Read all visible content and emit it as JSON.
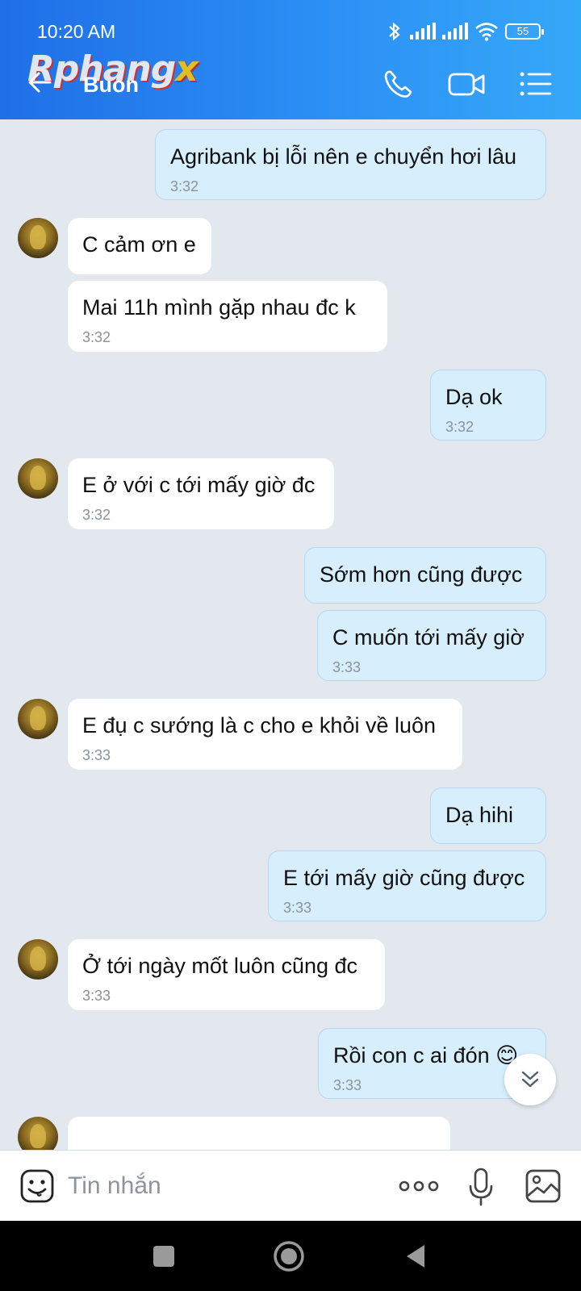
{
  "status": {
    "time": "10:20 AM",
    "battery": "55"
  },
  "header": {
    "title": "Buon",
    "watermark_main": "Rphang",
    "watermark_x": "x"
  },
  "messages": [
    {
      "dir": "out",
      "text": "Agribank bị lỗi nên e chuyển hơi lâu",
      "time": "3:32"
    },
    {
      "dir": "in",
      "text": "C cảm ơn e",
      "time": ""
    },
    {
      "dir": "in",
      "text": "Mai 11h mình gặp nhau đc k",
      "time": "3:32"
    },
    {
      "dir": "out",
      "text": "Dạ ok",
      "time": "3:32"
    },
    {
      "dir": "in",
      "text": "E ở với c tới mấy giờ đc",
      "time": "3:32"
    },
    {
      "dir": "out",
      "text": "Sớm hơn cũng được",
      "time": ""
    },
    {
      "dir": "out",
      "text": "C muốn tới mấy giờ",
      "time": "3:33"
    },
    {
      "dir": "in",
      "text": "E đụ c sướng là c cho e khỏi về luôn",
      "time": "3:33"
    },
    {
      "dir": "out",
      "text": "Dạ hihi",
      "time": ""
    },
    {
      "dir": "out",
      "text": "E tới mấy giờ cũng được",
      "time": "3:33"
    },
    {
      "dir": "in",
      "text": "Ở tới ngày mốt luôn cũng đc",
      "time": "3:33"
    },
    {
      "dir": "out",
      "text": "Rồi con c ai đón 😊",
      "time": "3:33"
    }
  ],
  "composer": {
    "placeholder": "Tin nhắn"
  },
  "icons": {
    "back": "arrow-left-icon",
    "call": "phone-icon",
    "video": "video-camera-icon",
    "menu": "list-menu-icon",
    "emoji": "sticker-face-icon",
    "more": "more-dots-icon",
    "mic": "microphone-icon",
    "image": "image-icon",
    "scroll": "chevrons-down-icon"
  },
  "colors": {
    "header_start": "#1f6fe6",
    "header_end": "#36a8f8",
    "bubble_out": "#d7eefc",
    "bubble_in": "#ffffff",
    "chat_bg": "#e3e8ef"
  }
}
